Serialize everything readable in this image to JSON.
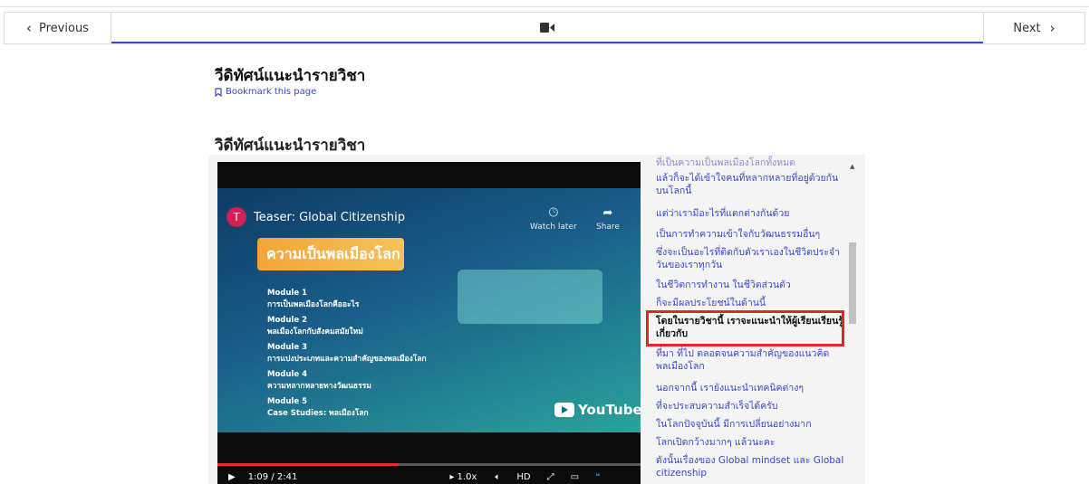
{
  "nav": {
    "previous_label": "Previous",
    "next_label": "Next",
    "video_tab_icon": "video-camera-icon"
  },
  "unit": {
    "title": "วีดิทัศน์แนะนำรายวิชา",
    "bookmark_label": "Bookmark this page",
    "video_heading": "วิดีทัศน์แนะนำรายวิชา"
  },
  "player": {
    "avatar_letter": "T",
    "title": "Teaser: Global Citizenship",
    "watch_later_label": "Watch later",
    "share_label": "Share",
    "banner_text": "ความเป็นพลเมืองโลก",
    "modules": [
      {
        "title": "Module 1",
        "sub": "การเป็นพลเมืองโลกคืออะไร"
      },
      {
        "title": "Module 2",
        "sub": "พลเมืองโลกกับสังคมสมัยใหม่"
      },
      {
        "title": "Module 3",
        "sub": "การแปงประเภทและความสำคัญของพลเมืองโลก"
      },
      {
        "title": "Module 4",
        "sub": "ความหลากหลายทางวัฒนธรรม"
      },
      {
        "title": "Module 5",
        "sub": "Case Studies: พลเมืองโลก"
      }
    ],
    "youtube_label": "YouTube",
    "time": "1:09 / 2:41",
    "speed": "1.0x",
    "hd": "HD",
    "progress_fraction": 0.4286
  },
  "transcript": [
    "ที่เป็นความเป็นพลเมืองโลกทั้งหมด",
    "แล้วก็จะได้เข้าใจคนที่หลากหลายที่อยู่ด้วยกันบนโลกนี้",
    "แต่ว่าเรามีอะไรที่แตกต่างกันด้วย",
    "เป็นการทำความเข้าใจกับวัฒนธรรมอื่นๆ",
    "ซึ่งจะเป็นอะไรที่ติดกับตัวเราเองในชีวิตประจำวันของเราทุกวัน",
    "ในชีวิตการทำงาน ในชีวิตส่วนตัว",
    "ก็จะมีผลประโยชน์ในด้านนี้",
    "โดยในรายวิชานี้ เราจะแนะนำให้ผู้เรียนเรียนรู้เกี่ยวกับ",
    "ที่มา ที่ไป ตลอดจนความสำคัญของแนวคิดพลเมืองโลก",
    "นอกจากนี้ เรายังแนะนำเทคนิคต่างๆ",
    "ที่จะประสบความสำเร็จได้ครับ",
    "ในโลกปัจจุบันนี้ มีการเปลี่ยนอย่างมาก",
    "โลกเปิดกว้างมากๆ แล้วนะคะ",
    "ดังนั้นเรื่องของ Global mindset และ Global citizenship"
  ]
}
